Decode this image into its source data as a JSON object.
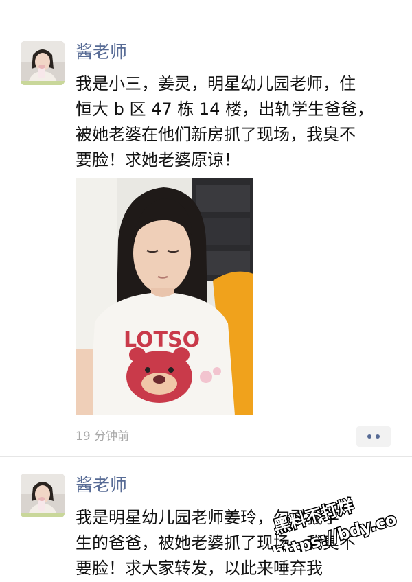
{
  "posts": [
    {
      "author": "酱老师",
      "lines": [
        "我是小三，姜灵，明星幼儿园老师，住",
        "恒大 b 区 47 栋 14 楼，出轨学生爸爸，",
        "被她老婆在他们新房抓了现场，我臭不",
        "要脸！求她老婆原谅！"
      ],
      "photo_shirt_text": "LOTSO",
      "time": "19 分钟前",
      "avatar_icon": "girl-portrait",
      "more_icon": "two-dots-icon"
    },
    {
      "author": "酱老师",
      "lines": [
        "我是明星幼儿园老师姜玲",
        "生的爸爸，被她老婆抓",
        "要脸！求大家转发，以此来唾弃我"
      ],
      "line_tails": [
        "，勾引我学",
        "了现场，我臭不",
        ""
      ],
      "avatar_icon": "girl-portrait"
    }
  ],
  "watermark": {
    "line1": "黑料不打烊",
    "line2": "https://bdy.co"
  },
  "colors": {
    "author": "#576b95",
    "text": "#111111",
    "time": "#a8a8a8",
    "more_bg": "#f2f2f2",
    "divider": "#e6e6e6"
  }
}
